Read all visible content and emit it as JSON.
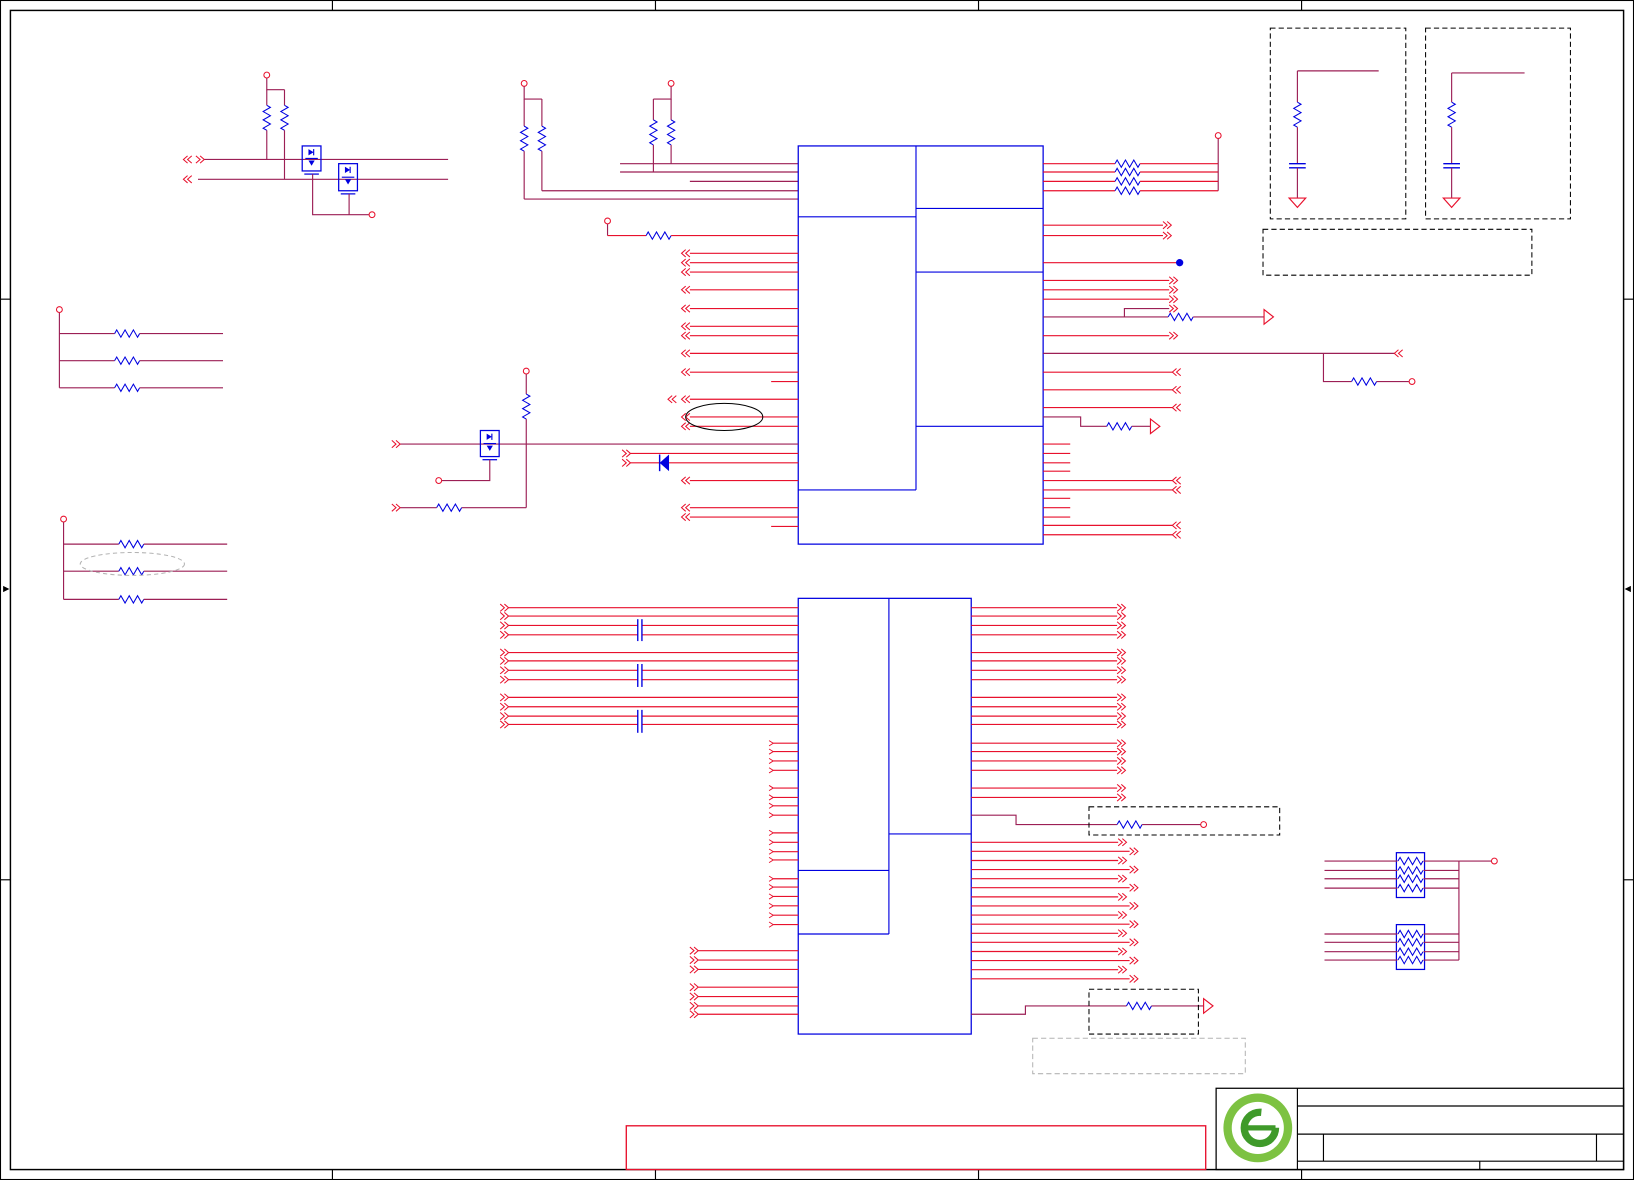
{
  "colors": {
    "frame": "#000000",
    "wire": "#9c1f55",
    "pin": "#e8112d",
    "component": "#0000e0",
    "note_box_light": "#b4b4b4",
    "red_box": "#e8112d",
    "logo_outer": "#7dc242",
    "logo_inner": "#3f9a2a"
  },
  "icons": {
    "logo": "company-logo-icon"
  }
}
